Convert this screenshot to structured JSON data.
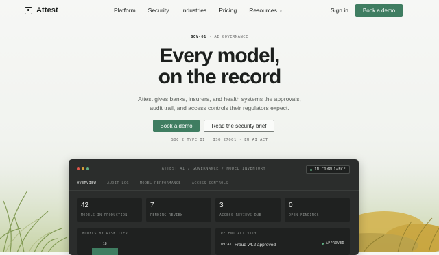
{
  "brand": {
    "name": "Attest"
  },
  "nav": {
    "links": [
      "Platform",
      "Security",
      "Industries",
      "Pricing",
      "Resources"
    ],
    "sign_in": "Sign in",
    "cta": "Book a demo"
  },
  "hero": {
    "eyebrow_code": "GOV-01",
    "eyebrow_sep": "·",
    "eyebrow_text": "AI GOVERNANCE",
    "headline_line1": "Every model,",
    "headline_line2": "on the record",
    "sub_line1": "Attest gives banks, insurers, and health systems the approvals,",
    "sub_line2": "audit trail, and access controls their regulators expect.",
    "cta_primary": "Book a demo",
    "cta_secondary": "Read the security brief",
    "badges": "SOC 2 TYPE II · ISO 27001 · EU AI ACT"
  },
  "dashboard": {
    "window_dots": [
      "#e0574c",
      "#d8a13a",
      "#5fae83"
    ],
    "title": "ATTEST AI / GOVERNANCE / MODEL INVENTORY",
    "status_badge": "IN COMPLIANCE",
    "tabs": [
      "OVERVIEW",
      "AUDIT LOG",
      "MODEL PERFORMANCE",
      "ACCESS CONTROLS"
    ],
    "stats": [
      {
        "value": "42",
        "label": "MODELS IN PRODUCTION"
      },
      {
        "value": "7",
        "label": "PENDING REVIEW"
      },
      {
        "value": "3",
        "label": "ACCESS REVIEWS DUE"
      },
      {
        "value": "0",
        "label": "OPEN FINDINGS"
      }
    ],
    "risk_panel": {
      "title": "MODELS BY RISK TIER",
      "first_value": "18"
    },
    "activity_panel": {
      "title": "RECENT ACTIVITY",
      "time": "09:41",
      "text": "Fraud v4.2 approved",
      "status": "APPROVED"
    }
  },
  "colors": {
    "accent": "#3f7d61",
    "dark": "#2b2d2c",
    "success": "#5fae83"
  }
}
